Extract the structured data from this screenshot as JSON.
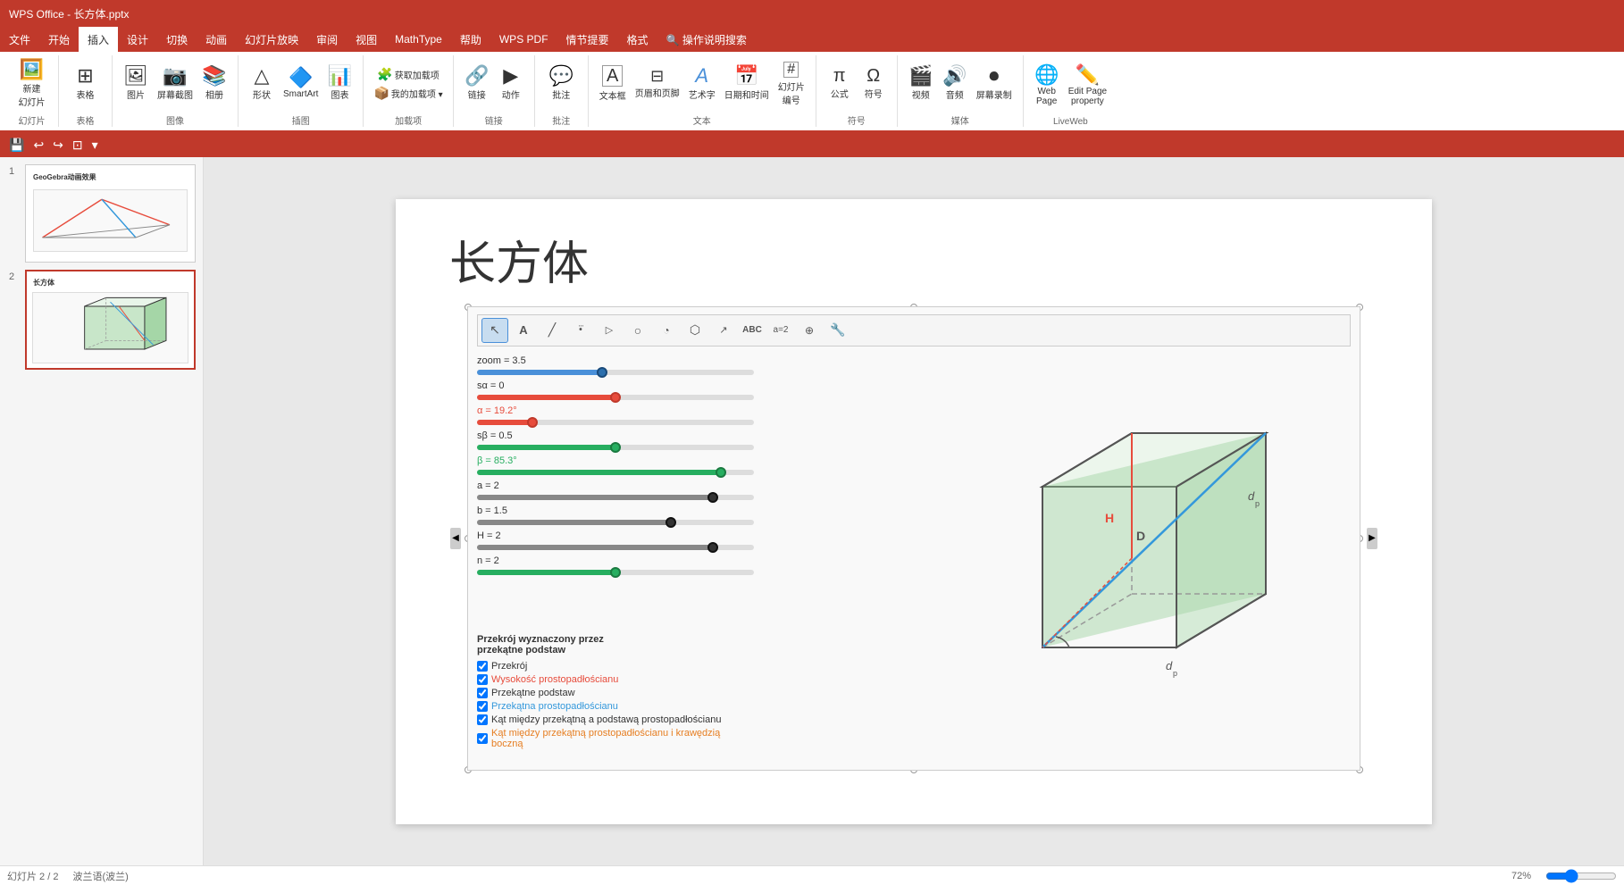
{
  "app": {
    "title": "WPS Office - 长方体.pptx"
  },
  "ribbon": {
    "tabs": [
      "文件",
      "开始",
      "插入",
      "设计",
      "切换",
      "动画",
      "幻灯片放映",
      "审阅",
      "视图",
      "MathType",
      "帮助",
      "WPS PDF",
      "情节提要",
      "格式",
      "操作说明搜索"
    ],
    "active_tab": "插入",
    "groups": [
      {
        "name": "幻灯片",
        "buttons": [
          {
            "label": "新建\n幻灯片",
            "icon": "🖼️"
          }
        ]
      },
      {
        "name": "表格",
        "buttons": [
          {
            "label": "表格",
            "icon": "⊞"
          }
        ]
      },
      {
        "name": "图像",
        "buttons": [
          {
            "label": "图片",
            "icon": "🖼"
          },
          {
            "label": "屏幕截图",
            "icon": "📷"
          },
          {
            "label": "相册",
            "icon": "📚"
          }
        ]
      },
      {
        "name": "插图",
        "buttons": [
          {
            "label": "形状",
            "icon": "△"
          },
          {
            "label": "SmartArt",
            "icon": "🔷"
          },
          {
            "label": "图表",
            "icon": "📊"
          }
        ]
      },
      {
        "name": "加载项",
        "buttons": [
          {
            "label": "获取加载项",
            "icon": "🧩"
          },
          {
            "label": "我的加载项",
            "icon": "📦"
          }
        ]
      },
      {
        "name": "链接",
        "buttons": [
          {
            "label": "链接",
            "icon": "🔗"
          },
          {
            "label": "动作",
            "icon": "▶"
          }
        ]
      },
      {
        "name": "批注",
        "buttons": [
          {
            "label": "批注",
            "icon": "💬"
          }
        ]
      },
      {
        "name": "文本",
        "buttons": [
          {
            "label": "文本框",
            "icon": "T"
          },
          {
            "label": "页眉和页脚",
            "icon": "⊟"
          },
          {
            "label": "艺术字",
            "icon": "A"
          },
          {
            "label": "日期和时间",
            "icon": "📅"
          },
          {
            "label": "幻灯片\n编号",
            "icon": "#"
          }
        ]
      },
      {
        "name": "符号",
        "buttons": [
          {
            "label": "公式",
            "icon": "π"
          },
          {
            "label": "符号",
            "icon": "Ω"
          }
        ]
      },
      {
        "name": "媒体",
        "buttons": [
          {
            "label": "视频",
            "icon": "🎬"
          },
          {
            "label": "音频",
            "icon": "🔊"
          },
          {
            "label": "屏幕录制",
            "icon": "⏺"
          }
        ]
      },
      {
        "name": "LiveWeb",
        "buttons": [
          {
            "label": "Web\nPage",
            "icon": "🌐"
          },
          {
            "label": "Edit Page\nproperty",
            "icon": "✏️"
          }
        ]
      }
    ]
  },
  "quick_access": {
    "buttons": [
      "💾",
      "↩",
      "↪",
      "⊡",
      "▾"
    ]
  },
  "slides": [
    {
      "num": "1",
      "title": "GeoGebra动画效果",
      "active": false
    },
    {
      "num": "2",
      "title": "长方体",
      "active": true
    }
  ],
  "slide": {
    "title": "长方体",
    "geogebra": {
      "toolbar_tools": [
        "cursor",
        "A",
        "line",
        "point",
        "circle",
        "arc",
        "polygon",
        "ray",
        "ABC",
        "transform",
        "wrench"
      ],
      "sliders": [
        {
          "label": "zoom = 3.5",
          "value": 0.45,
          "color": "blue"
        },
        {
          "label": "sα = 0",
          "value": 0.5,
          "color": "red"
        },
        {
          "label": "α = 19.2°",
          "value": 0.2,
          "color": "red"
        },
        {
          "label": "sβ = 0.5",
          "value": 0.5,
          "color": "green"
        },
        {
          "label": "β = 85.3°",
          "value": 0.9,
          "color": "green"
        },
        {
          "label": "a = 2",
          "value": 0.85,
          "color": "dark"
        },
        {
          "label": "b = 1.5",
          "value": 0.7,
          "color": "dark"
        },
        {
          "label": "H = 2",
          "value": 0.85,
          "color": "dark"
        },
        {
          "label": "n = 2",
          "value": 0.5,
          "color": "green"
        }
      ],
      "checkboxes_title": "Przekrój wyznaczony przez\nprzekątne podstaw",
      "checkboxes": [
        {
          "label": "Przekrój",
          "color": "dark",
          "checked": true
        },
        {
          "label": "Wysokość prostopadłościanu",
          "color": "red",
          "checked": true
        },
        {
          "label": "Przekątne podstaw",
          "color": "dark",
          "checked": true
        },
        {
          "label": "Przekątna prostopadłościanu",
          "color": "blue",
          "checked": true
        },
        {
          "label": "Kąt między przekątną a podstawą prostopadłościanu",
          "color": "dark",
          "checked": true
        },
        {
          "label": "Kąt między przekątną prostopadłościanu i krawędzią boczną",
          "color": "orange",
          "checked": true
        }
      ]
    }
  },
  "status": {
    "slide_info": "幻灯片 2 / 2",
    "language": "波兰语(波兰)",
    "zoom": "72%"
  }
}
